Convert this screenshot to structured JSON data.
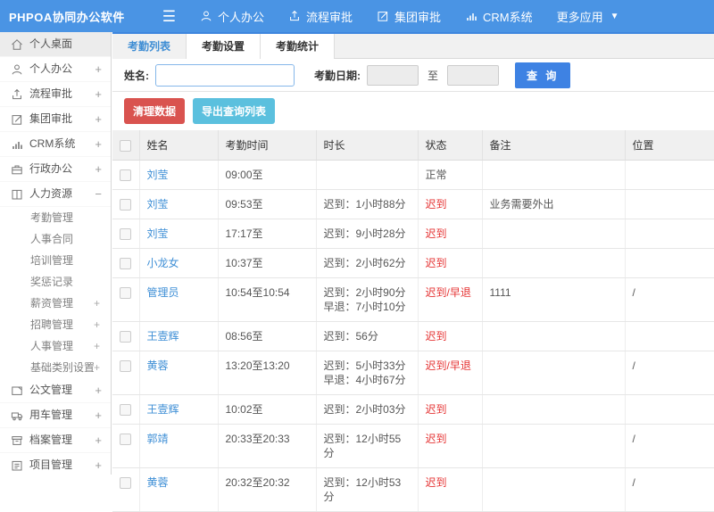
{
  "navbar": {
    "logo": "PHPOA协同办公软件",
    "items": [
      {
        "label": "个人办公",
        "icon": "user-icon"
      },
      {
        "label": "流程审批",
        "icon": "flow-icon"
      },
      {
        "label": "集团审批",
        "icon": "edit-icon"
      },
      {
        "label": "CRM系统",
        "icon": "chart-icon"
      },
      {
        "label": "更多应用",
        "icon": "caret-down-icon"
      }
    ]
  },
  "sidebar": {
    "items": [
      {
        "label": "个人桌面",
        "icon": "home-icon",
        "expand": "",
        "active": true
      },
      {
        "label": "个人办公",
        "icon": "user-icon",
        "expand": "+"
      },
      {
        "label": "流程审批",
        "icon": "flow-icon",
        "expand": "+"
      },
      {
        "label": "集团审批",
        "icon": "edit-icon",
        "expand": "+"
      },
      {
        "label": "CRM系统",
        "icon": "chart-icon",
        "expand": "+"
      },
      {
        "label": "行政办公",
        "icon": "briefcase-icon",
        "expand": "+"
      },
      {
        "label": "人力资源",
        "icon": "book-icon",
        "expand": "−",
        "children": [
          {
            "label": "考勤管理",
            "expand": ""
          },
          {
            "label": "人事合同",
            "expand": ""
          },
          {
            "label": "培训管理",
            "expand": ""
          },
          {
            "label": "奖惩记录",
            "expand": ""
          },
          {
            "label": "薪资管理",
            "expand": "+"
          },
          {
            "label": "招聘管理",
            "expand": "+"
          },
          {
            "label": "人事管理",
            "expand": "+"
          },
          {
            "label": "基础类别设置",
            "expand": "+"
          }
        ]
      },
      {
        "label": "公文管理",
        "icon": "doc-icon",
        "expand": "+"
      },
      {
        "label": "用车管理",
        "icon": "truck-icon",
        "expand": "+"
      },
      {
        "label": "档案管理",
        "icon": "archive-icon",
        "expand": "+"
      },
      {
        "label": "项目管理",
        "icon": "project-icon",
        "expand": "+"
      }
    ]
  },
  "tabs": [
    {
      "label": "考勤列表",
      "active": true
    },
    {
      "label": "考勤设置",
      "active": false
    },
    {
      "label": "考勤统计",
      "active": false
    }
  ],
  "search": {
    "name_label": "姓名:",
    "name_value": "",
    "date_label": "考勤日期:",
    "date_from": "",
    "to_label": "至",
    "date_to": "",
    "query_button": "查 询"
  },
  "actions": {
    "clean_button": "清理数据",
    "export_button": "导出查询列表"
  },
  "table": {
    "headers": [
      "姓名",
      "考勤时间",
      "时长",
      "状态",
      "备注",
      "位置"
    ],
    "rows": [
      {
        "name": "刘莹",
        "time": "09:00至",
        "duration": [],
        "status": "正常",
        "status_type": "normal",
        "remark": "",
        "location": ""
      },
      {
        "name": "刘莹",
        "time": "09:53至",
        "duration": [
          "迟到：1小时88分"
        ],
        "status": "迟到",
        "status_type": "late",
        "remark": "业务需要外出",
        "location": ""
      },
      {
        "name": "刘莹",
        "time": "17:17至",
        "duration": [
          "迟到：9小时28分"
        ],
        "status": "迟到",
        "status_type": "late",
        "remark": "",
        "location": ""
      },
      {
        "name": "小龙女",
        "time": "10:37至",
        "duration": [
          "迟到：2小时62分"
        ],
        "status": "迟到",
        "status_type": "late",
        "remark": "",
        "location": ""
      },
      {
        "name": "管理员",
        "time": "10:54至10:54",
        "duration": [
          "迟到：2小时90分",
          "早退：7小时10分"
        ],
        "status": "迟到/早退",
        "status_type": "late",
        "remark": "1111",
        "location": "/"
      },
      {
        "name": "王壹辉",
        "time": "08:56至",
        "duration": [
          "迟到：56分"
        ],
        "status": "迟到",
        "status_type": "late",
        "remark": "",
        "location": ""
      },
      {
        "name": "黄蓉",
        "time": "13:20至13:20",
        "duration": [
          "迟到：5小时33分",
          "早退：4小时67分"
        ],
        "status": "迟到/早退",
        "status_type": "late",
        "remark": "",
        "location": "/"
      },
      {
        "name": "王壹辉",
        "time": "10:02至",
        "duration": [
          "迟到：2小时03分"
        ],
        "status": "迟到",
        "status_type": "late",
        "remark": "",
        "location": ""
      },
      {
        "name": "郭靖",
        "time": "20:33至20:33",
        "duration": [
          "迟到：12小时55分"
        ],
        "status": "迟到",
        "status_type": "late",
        "remark": "",
        "location": "/"
      },
      {
        "name": "黄蓉",
        "time": "20:32至20:32",
        "duration": [
          "迟到：12小时53分"
        ],
        "status": "迟到",
        "status_type": "late",
        "remark": "",
        "location": "/"
      }
    ]
  },
  "colors": {
    "navbar_blue": "#4a94e4",
    "primary_blue": "#3e82e3",
    "link_blue": "#3f8fd6",
    "danger_red": "#d9534f",
    "info_cyan": "#5bc0de",
    "status_red": "#e53333"
  }
}
